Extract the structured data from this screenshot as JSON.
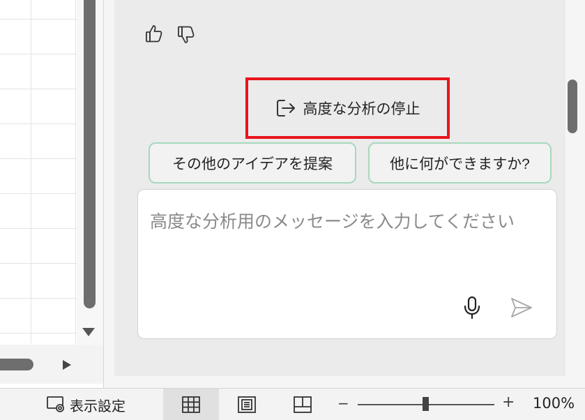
{
  "copilot": {
    "stop_button_label": "高度な分析の停止",
    "suggestions": [
      "その他のアイデアを提案",
      "他に何ができますか?"
    ],
    "input": {
      "value": "",
      "placeholder": "高度な分析用のメッセージを入力してください"
    }
  },
  "statusbar": {
    "display_settings_label": "表示設定",
    "zoom_minus": "−",
    "zoom_plus": "+",
    "zoom_level": "100%",
    "zoom_value_percent": 100
  },
  "icons": {
    "thumbs_up": "thumbs-up-icon",
    "thumbs_down": "thumbs-down-icon",
    "exit": "exit-icon",
    "microphone": "microphone-icon",
    "send": "send-icon",
    "display_settings": "display-settings-icon",
    "normal_view": "grid-icon",
    "page_layout_view": "page-layout-icon",
    "page_break_view": "page-break-icon"
  },
  "colors": {
    "highlight_border": "#e8141b",
    "chip_border": "#a6d8bd",
    "pane_background": "#ebebeb"
  }
}
